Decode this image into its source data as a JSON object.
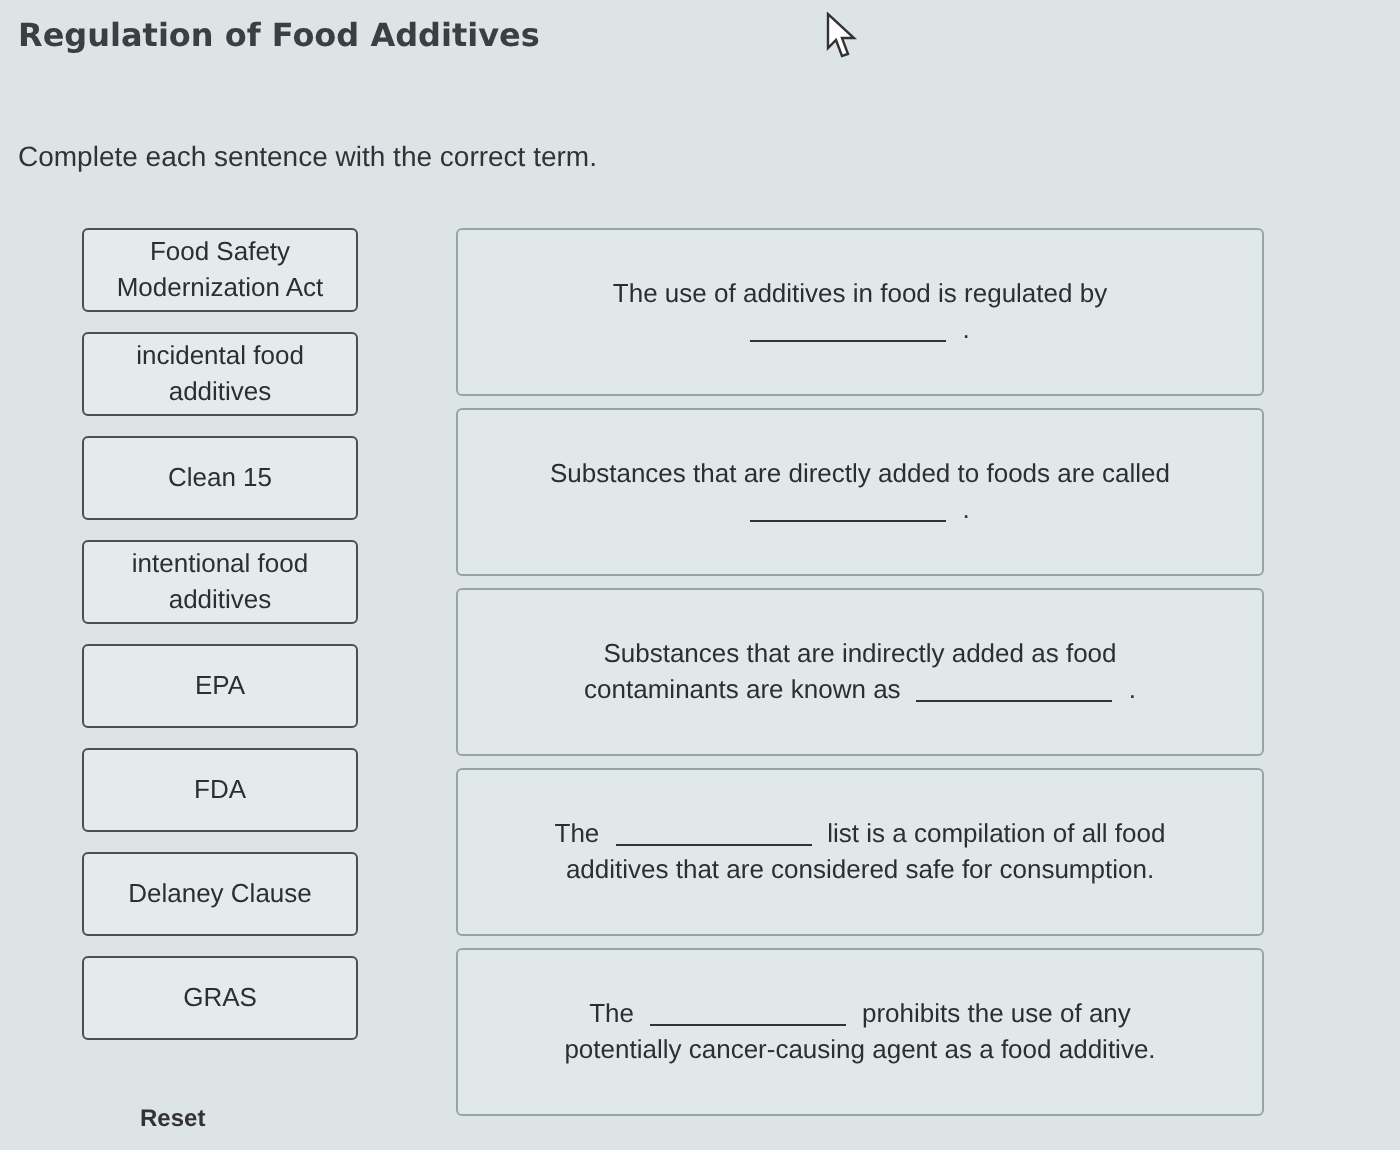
{
  "title": "Regulation of Food Additives",
  "instruction": "Complete each sentence with the correct term.",
  "terms": [
    "Food Safety Modernization Act",
    "incidental food additives",
    "Clean 15",
    "intentional food additives",
    "EPA",
    "FDA",
    "Delaney Clause",
    "GRAS"
  ],
  "sentences": [
    {
      "lines": [
        [
          {
            "kind": "text",
            "text": "The use of additives in food is regulated by"
          }
        ],
        [
          {
            "kind": "blank"
          },
          {
            "kind": "text",
            "text": "."
          }
        ]
      ]
    },
    {
      "lines": [
        [
          {
            "kind": "text",
            "text": "Substances that are directly added to foods are called"
          }
        ],
        [
          {
            "kind": "blank"
          },
          {
            "kind": "text",
            "text": "."
          }
        ]
      ]
    },
    {
      "lines": [
        [
          {
            "kind": "text",
            "text": "Substances that are indirectly added as food"
          }
        ],
        [
          {
            "kind": "text",
            "text": "contaminants are known as"
          },
          {
            "kind": "blank"
          },
          {
            "kind": "text",
            "text": "."
          }
        ]
      ]
    },
    {
      "lines": [
        [
          {
            "kind": "text",
            "text": "The"
          },
          {
            "kind": "blank"
          },
          {
            "kind": "text",
            "text": "list is a compilation of all food"
          }
        ],
        [
          {
            "kind": "text",
            "text": "additives that are considered safe for consumption."
          }
        ]
      ]
    },
    {
      "lines": [
        [
          {
            "kind": "text",
            "text": "The"
          },
          {
            "kind": "blank"
          },
          {
            "kind": "text",
            "text": "prohibits the use of any"
          }
        ],
        [
          {
            "kind": "text",
            "text": "potentially cancer-causing agent as a food additive."
          }
        ]
      ]
    }
  ],
  "reset_label": "Reset"
}
